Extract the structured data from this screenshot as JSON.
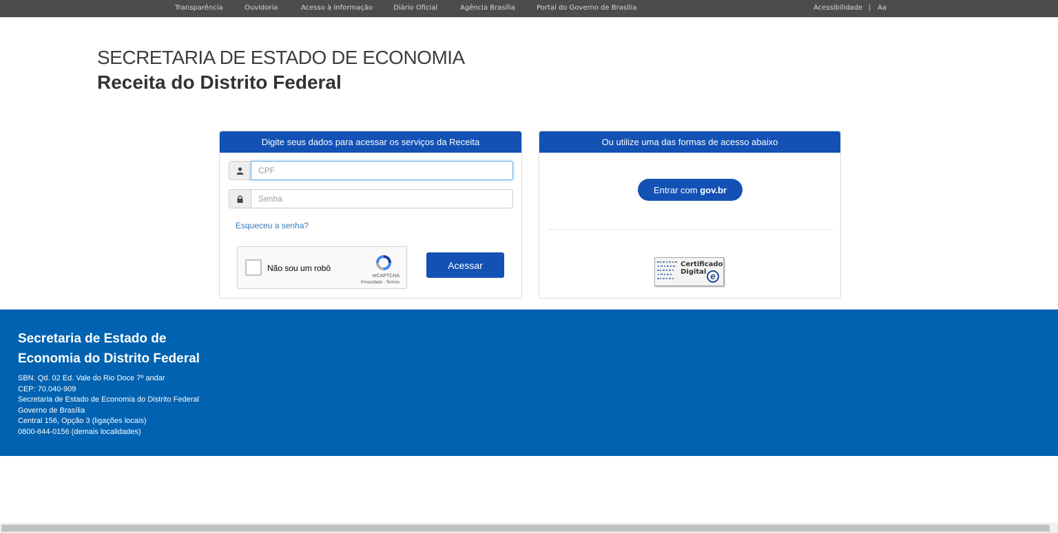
{
  "topbar": {
    "links": [
      "Transparência",
      "Ouvidoria",
      "Acesso à Informação",
      "Diário Oficial",
      "Agência Brasília",
      "Portal do Governo de Brasília"
    ],
    "accessibility": "Acessibilidade",
    "separator": "|",
    "font_size": "Aa"
  },
  "header": {
    "org": "SECRETARIA DE ESTADO DE ECONOMIA",
    "unit": "Receita do Distrito Federal"
  },
  "login_panel": {
    "title": "Digite seus dados para acessar os serviços da Receita",
    "cpf_placeholder": "CPF",
    "cpf_value": "",
    "senha_placeholder": "Senha",
    "senha_value": "",
    "forgot_link": "Esqueceu a senha?",
    "submit_label": "Acessar"
  },
  "recaptcha": {
    "label": "Não sou um robô",
    "brand": "reCAPTCHA",
    "privacy": "Privacidade",
    "links_sep": " - ",
    "terms": "Termos"
  },
  "alt_panel": {
    "title": "Ou utilize uma das formas de acesso abaixo",
    "govbr_prefix": "Entrar com ",
    "govbr_brand": "gov.br",
    "certificate_line1": "Certificado",
    "certificate_line2": "Digital",
    "certificate_mark": "e"
  },
  "footer": {
    "title_line1": "Secretaria de Estado de",
    "title_line2": "Economia do Distrito Federal",
    "lines": [
      "SBN. Qd. 02 Ed. Vale do Rio Doce 7º andar",
      "CEP: 70.040-909",
      "Secretaria de Estado de Economia do Distrito Federal",
      "Governo de Brasília",
      "Central 156, Opção 3 (ligações locais)",
      "0800-644-0156 (demais localidades)"
    ]
  },
  "colors": {
    "topbar": "#4c4c4c",
    "primary": "#1351b4",
    "footer": "#0062b0"
  }
}
